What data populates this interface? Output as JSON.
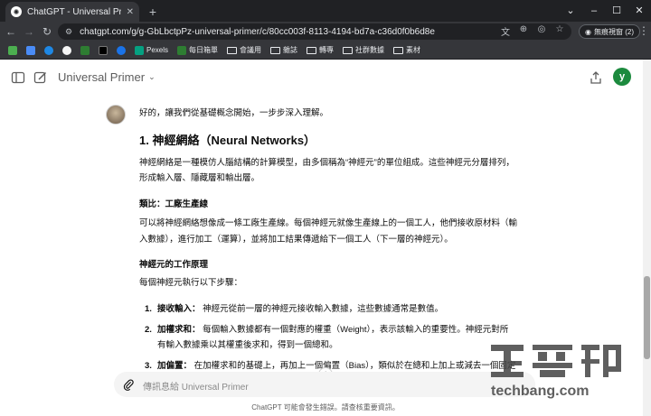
{
  "browser": {
    "tab_title": "ChatGPT - Universal Primer",
    "url": "chatgpt.com/g/g-GbLbctpPz-universal-primer/c/80cc003f-8113-4194-bd7a-c36d0f0b6d8e",
    "profile_label": "無痕視窗 (2)",
    "bookmarks": [
      "Pexels",
      "每日箱單",
      "會議用",
      "雜誌",
      "轉專",
      "社群數據",
      "素材"
    ]
  },
  "app": {
    "model_name": "Universal Primer",
    "user_initial": "y",
    "composer_placeholder": "傳訊息給 Universal Primer",
    "disclaimer": "ChatGPT 可能會發生錯誤。請查核重要資訊。"
  },
  "message": {
    "intro": "好的，讓我們從基礎概念開始，一步步深入理解。",
    "heading": "1. 神經網絡（Neural Networks）",
    "para1_line1": "神經網絡是一種模仿人腦結構的計算模型，由多個稱為“神經元”的單位組成。這些神經元分層排列，",
    "para1_line2": "形成輸入層、隱藏層和輸出層。",
    "sub1": "類比：工廠生產線",
    "para2_line1": "可以將神經網絡想像成一條工廠生產線。每個神經元就像生產線上的一個工人，他們接收原材料（輸",
    "para2_line2": "入數據），進行加工（運算），並將加工結果傳遞給下一個工人（下一層的神經元）。",
    "sub2": "神經元的工作原理",
    "para3": "每個神經元執行以下步驟：",
    "steps": [
      {
        "num": "1.",
        "title": "接收輸入：",
        "text": "神經元從前一層的神經元接收輸入數據，這些數據通常是數值。"
      },
      {
        "num": "2.",
        "title": "加權求和：",
        "text": "每個輸入數據都有一個對應的權重（Weight），表示該輸入的重要性。神經元對所",
        "text2": "有輸入數據乘以其權重後求和，得到一個總和。"
      },
      {
        "num": "3.",
        "title": "加偏置：",
        "text": "在加權求和的基礎上，再加上一個偏置（Bias），類似於在總和上加上或減去一個固定"
      }
    ]
  },
  "watermark": {
    "text": "techbang.com"
  }
}
